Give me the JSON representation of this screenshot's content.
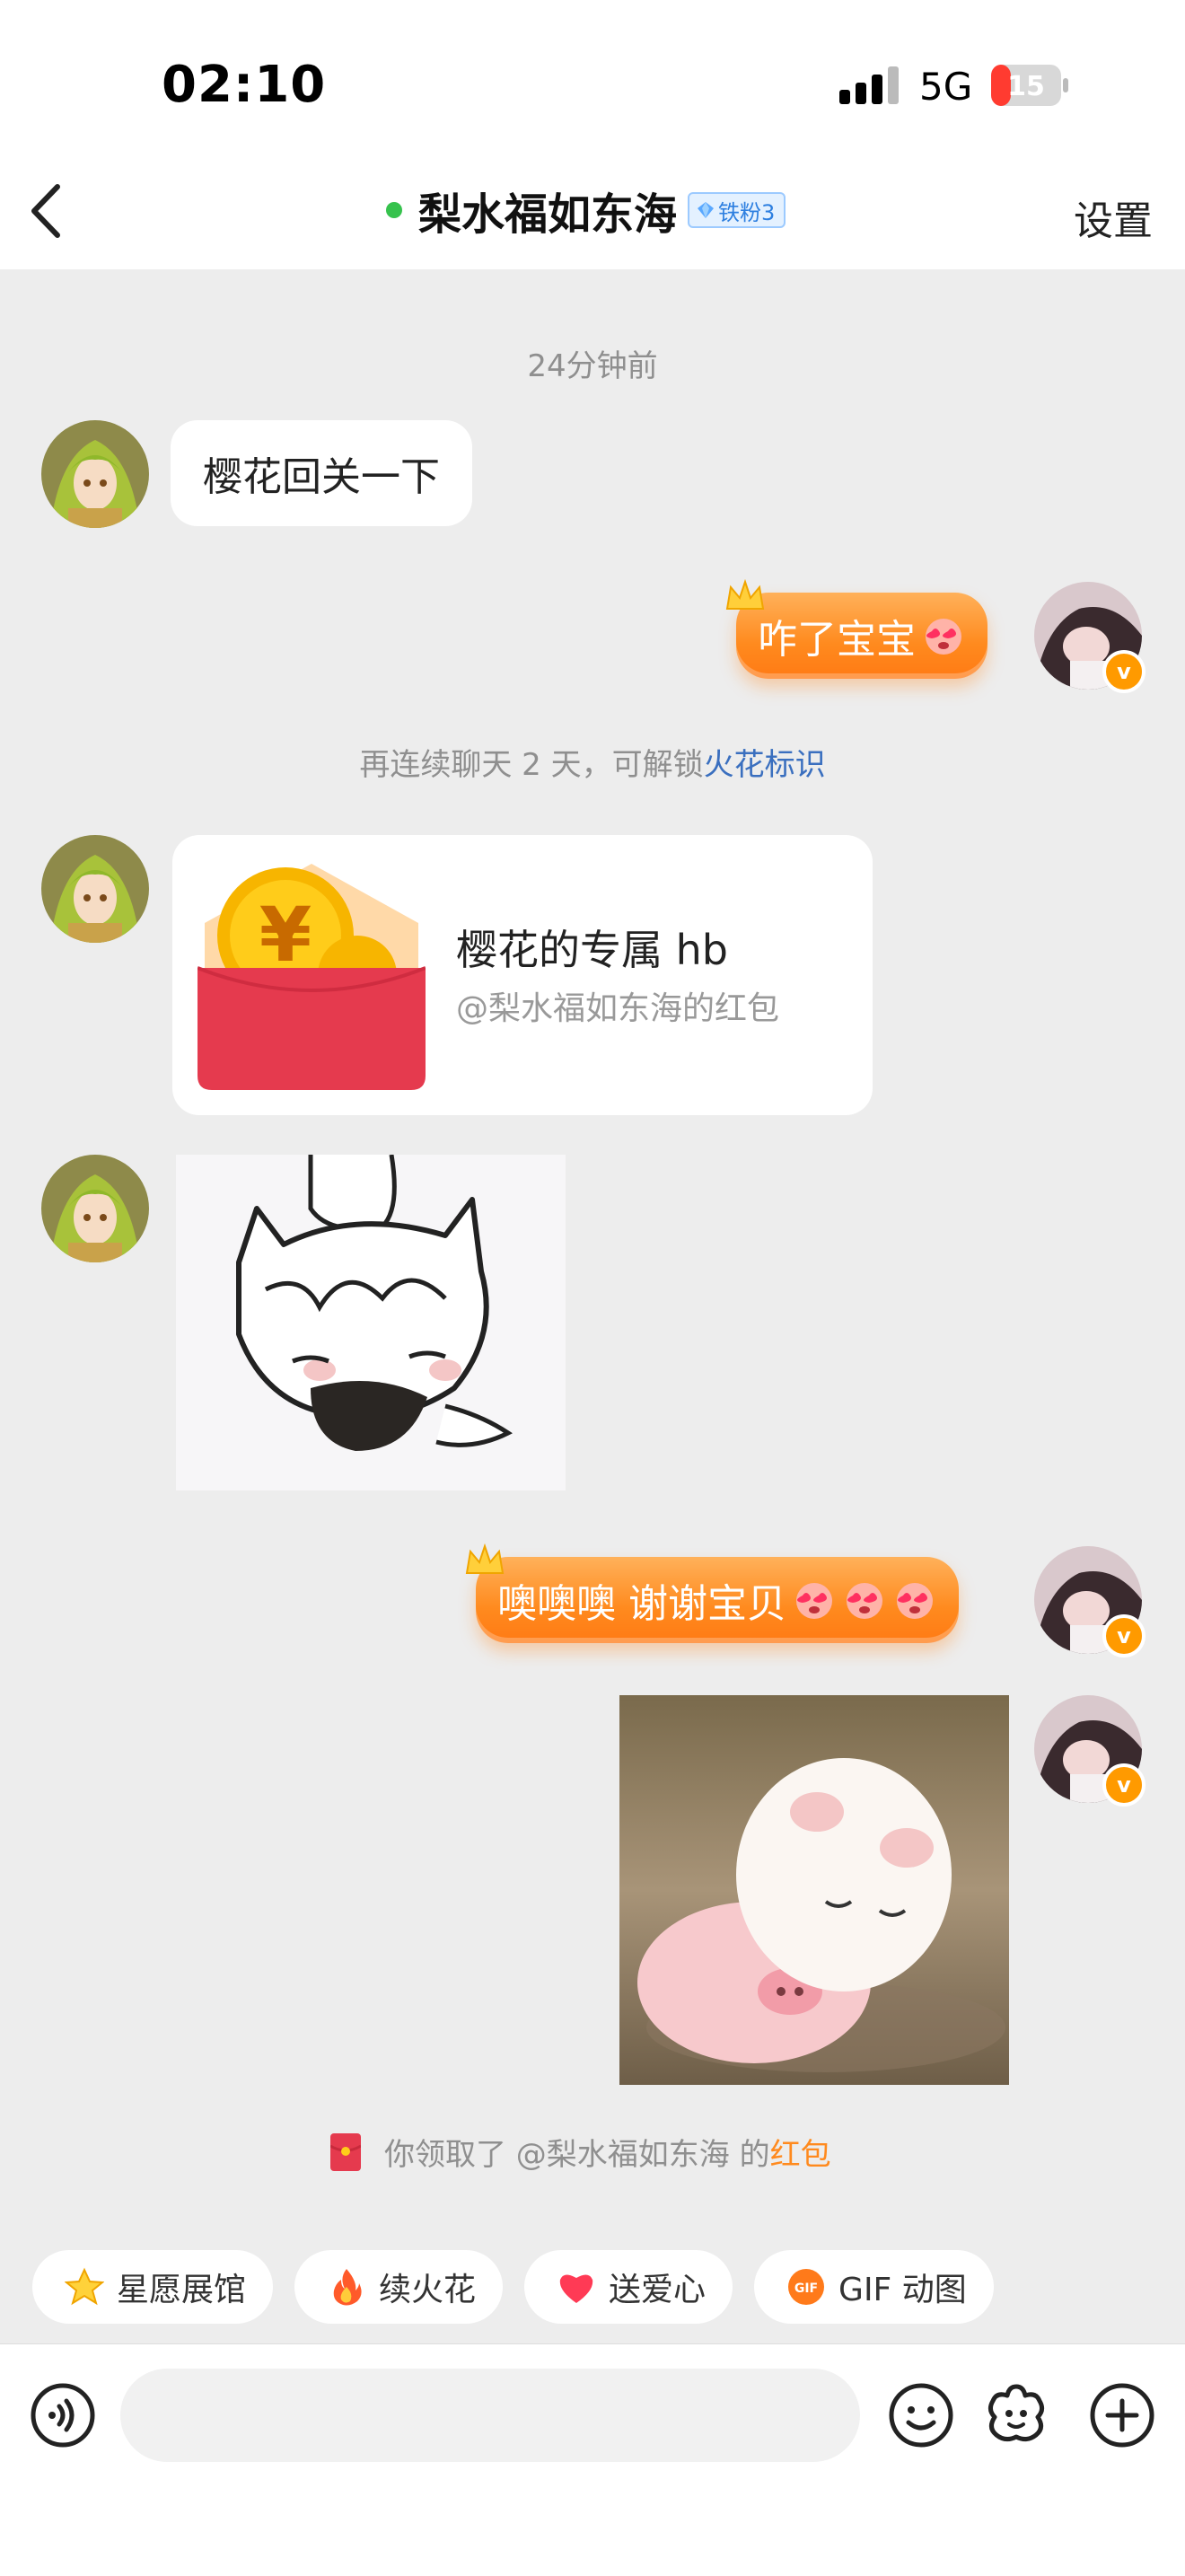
{
  "status": {
    "time": "02:10",
    "network": "5G",
    "battery": "15"
  },
  "nav": {
    "title": "梨水福如东海",
    "fan_badge": "铁粉3",
    "settings_label": "设置"
  },
  "chat": {
    "timestamp": "24分钟前",
    "msg1": "樱花回关一下",
    "msg2": "咋了宝宝",
    "system1_prefix": "再连续聊天 2 天，可解锁",
    "system1_link": "火花标识",
    "red_packet": {
      "title": "樱花的专属 hb",
      "subtitle": "@梨水福如东海的红包"
    },
    "msg3": "噢噢噢 谢谢宝贝",
    "system2_prefix": "你领取了 @梨水福如东海 的",
    "system2_link": "红包"
  },
  "quick_actions": [
    {
      "label": "星愿展馆",
      "icon": "star-icon"
    },
    {
      "label": "续火花",
      "icon": "fire-icon"
    },
    {
      "label": "送爱心",
      "icon": "heart-icon"
    },
    {
      "label": "GIF 动图",
      "icon": "gif-icon"
    }
  ],
  "input": {
    "placeholder": ""
  },
  "colors": {
    "accent_orange": "#ff8a1e",
    "link_blue": "#3a6fbf",
    "online_green": "#36c24d",
    "red_packet": "#e53a4e"
  }
}
